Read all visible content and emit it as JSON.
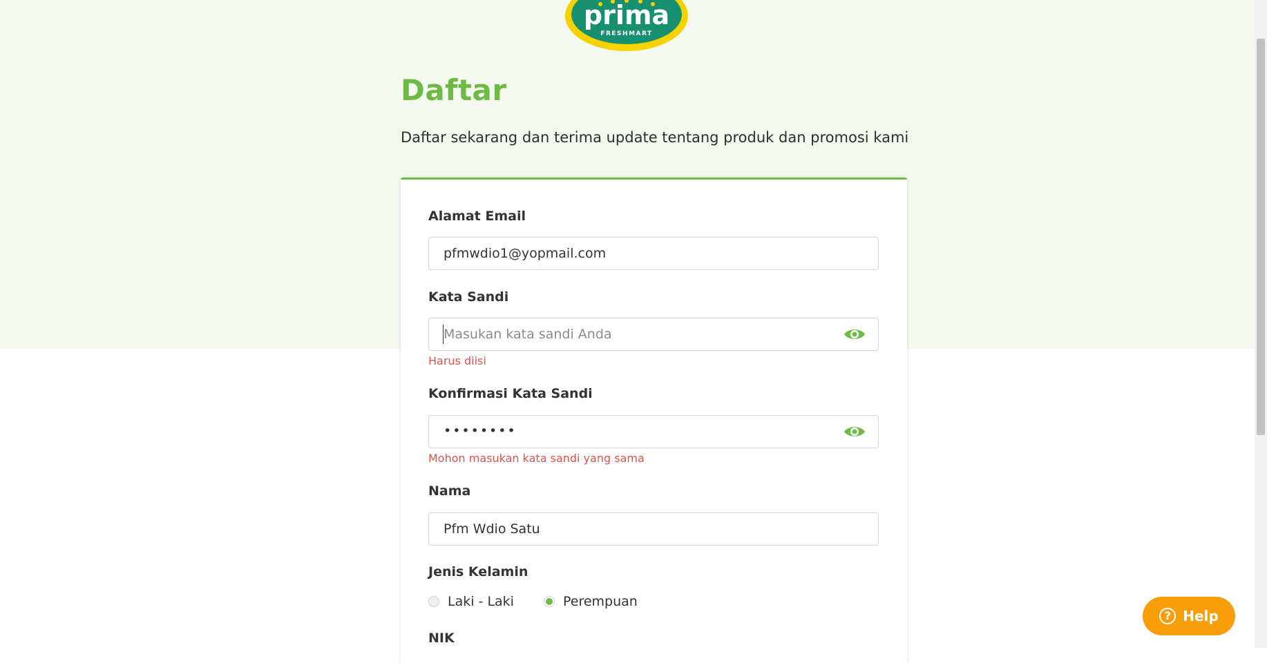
{
  "brand": {
    "logo_text": "prima",
    "logo_subtext": "FRESHMART",
    "colors": {
      "green": "#6dbb45",
      "teal": "#17906f",
      "yellow": "#f6d200",
      "help_orange": "#f79e0a",
      "error_red": "#d9534f"
    }
  },
  "header": {
    "title": "Daftar",
    "subtitle": "Daftar sekarang dan terima update tentang produk dan promosi kami"
  },
  "form": {
    "email": {
      "label": "Alamat Email",
      "value": "pfmwdio1@yopmail.com"
    },
    "password": {
      "label": "Kata Sandi",
      "placeholder": "Masukan kata sandi Anda",
      "value": "",
      "error": "Harus diisi",
      "toggle_icon": "eye-icon"
    },
    "confirm_password": {
      "label": "Konfirmasi Kata Sandi",
      "masked_value": "••••••••",
      "error": "Mohon masukan kata sandi yang sama",
      "toggle_icon": "eye-icon"
    },
    "name": {
      "label": "Nama",
      "value": "Pfm Wdio Satu"
    },
    "gender": {
      "label": "Jenis Kelamin",
      "options": [
        {
          "label": "Laki - Laki",
          "selected": false
        },
        {
          "label": "Perempuan",
          "selected": true
        }
      ]
    },
    "nik": {
      "label": "NIK"
    }
  },
  "help_button": {
    "label": "Help",
    "icon": "question-circle-icon"
  }
}
